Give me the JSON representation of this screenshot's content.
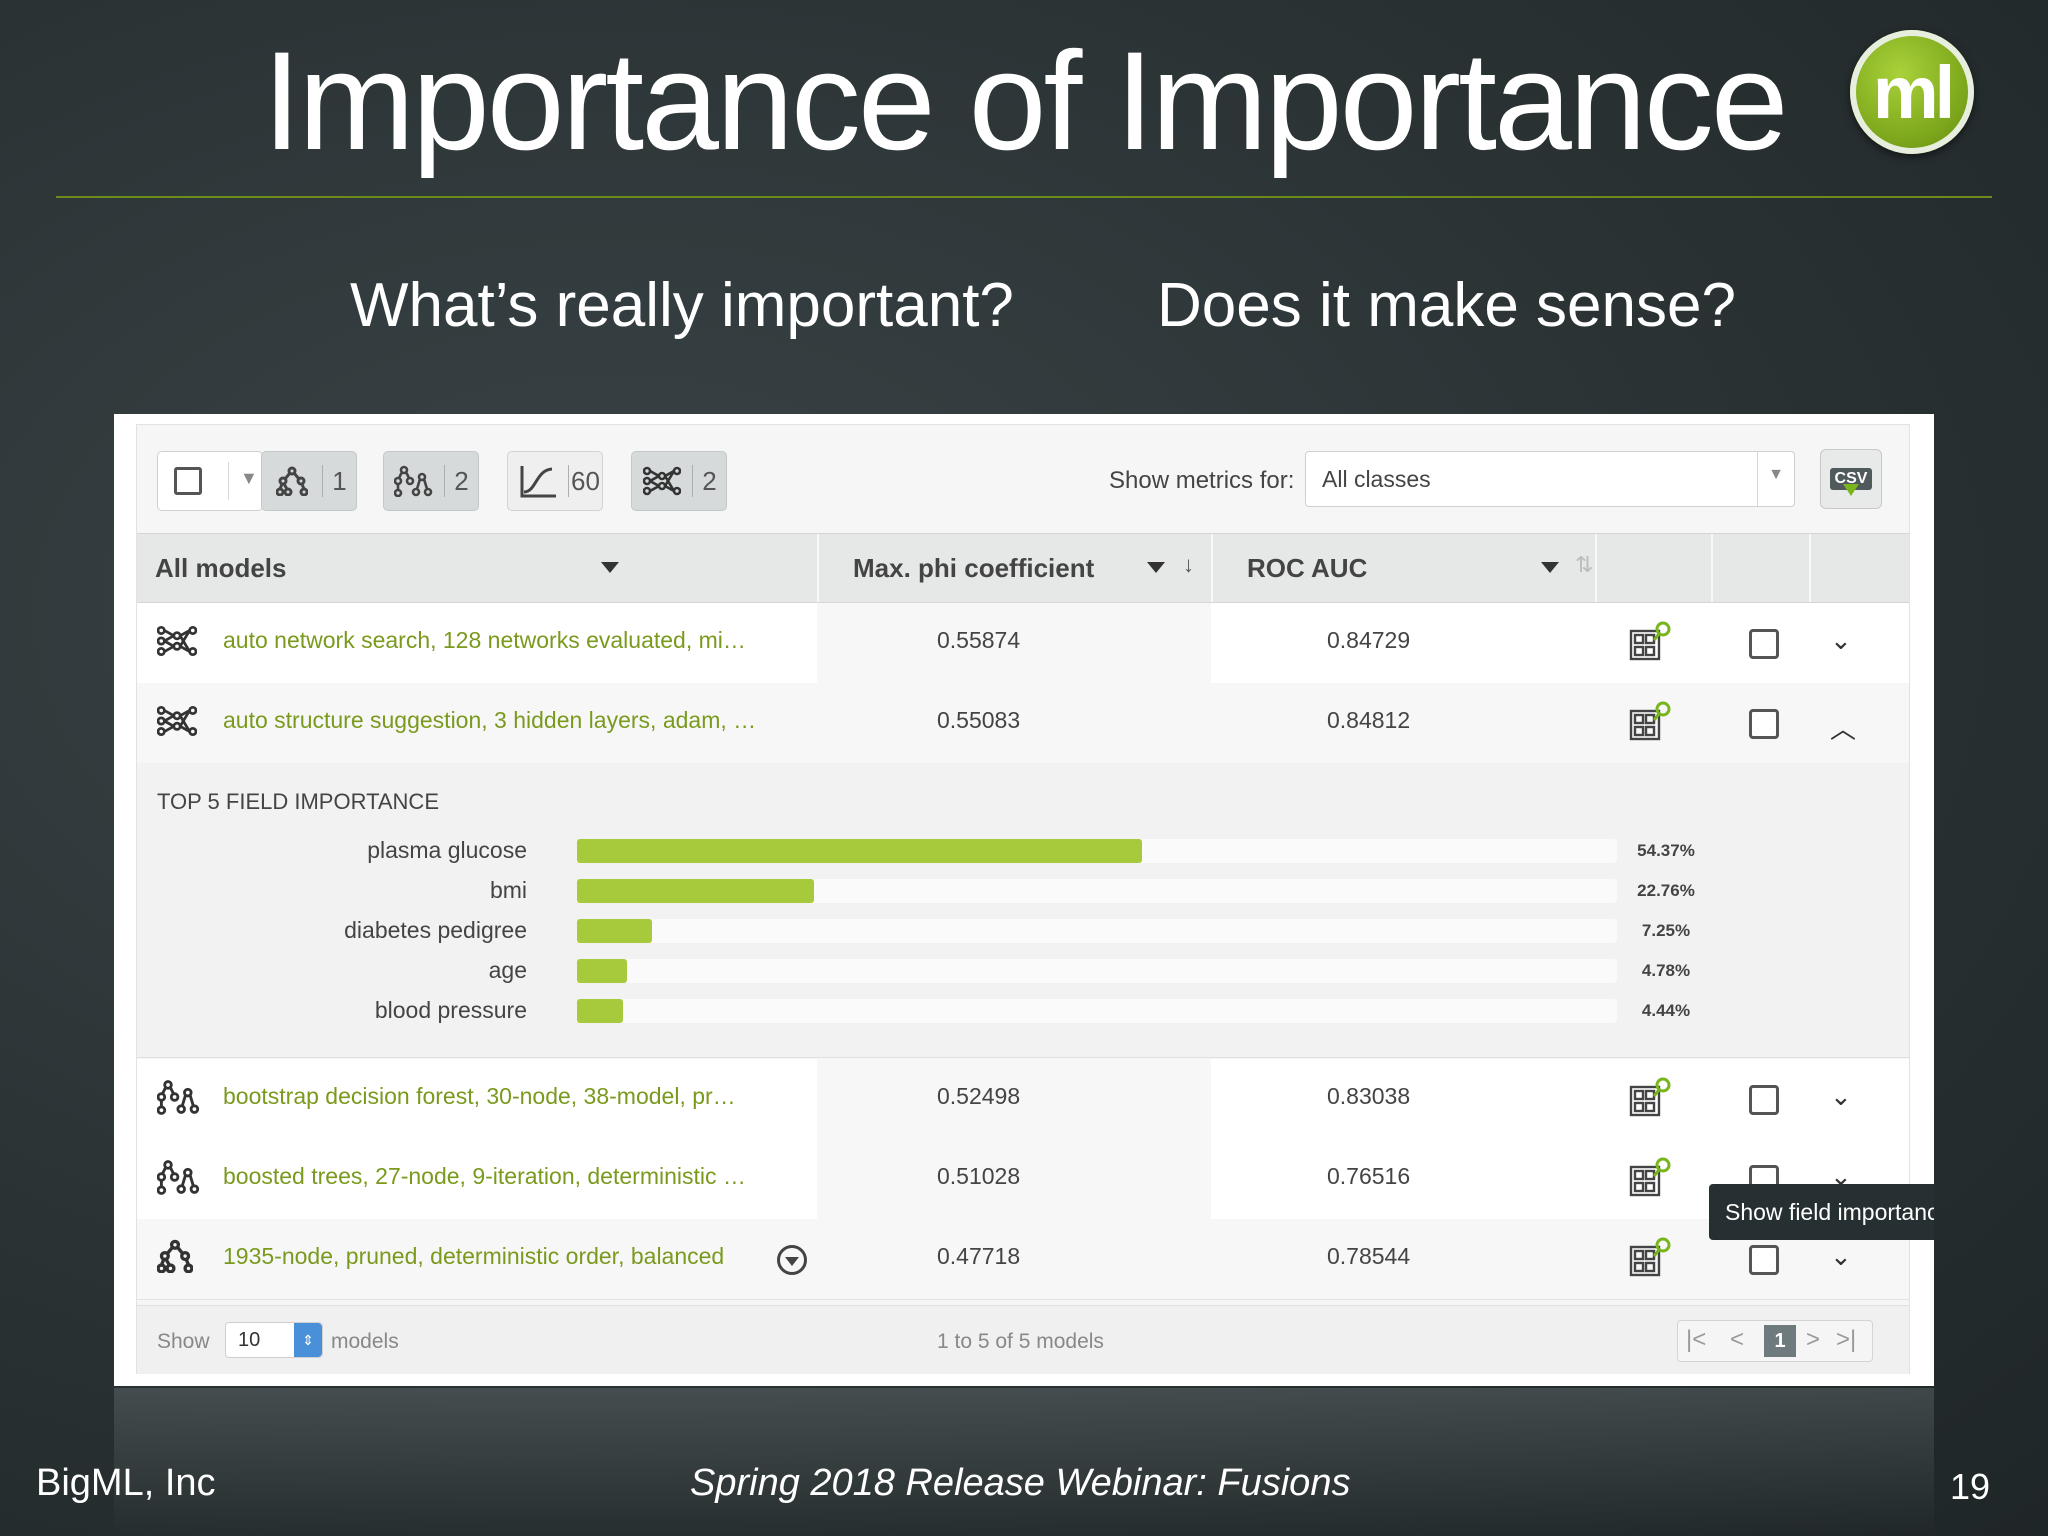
{
  "slide": {
    "title": "Importance of Importance",
    "logo_text": "ml",
    "question_left": "What’s really important?",
    "question_right": "Does it make sense?",
    "footer_left": "BigML, Inc",
    "footer_center": "Spring 2018 Release Webinar: Fusions",
    "page_number": "19"
  },
  "toolbar": {
    "filters": [
      {
        "icon": "tree-model-icon",
        "count": "1"
      },
      {
        "icon": "ensemble-icon",
        "count": "2"
      },
      {
        "icon": "logistic-regression-icon",
        "count": "60"
      },
      {
        "icon": "deepnet-icon",
        "count": "2"
      }
    ],
    "metrics_label": "Show metrics for:",
    "metrics_value": "All classes",
    "csv_label": "CSV"
  },
  "table": {
    "headers": {
      "name": "All models",
      "phi": "Max. phi coefficient",
      "roc": "ROC AUC"
    },
    "rows": [
      {
        "icon": "deepnet-icon",
        "name": "auto network search, 128 networks evaluated, mi…",
        "phi": "0.55874",
        "roc": "0.84729",
        "expanded": false
      },
      {
        "icon": "deepnet-icon",
        "name": "auto structure suggestion, 3 hidden layers, adam, …",
        "phi": "0.55083",
        "roc": "0.84812",
        "expanded": true
      },
      {
        "icon": "ensemble-icon",
        "name": "bootstrap decision forest, 30-node, 38-model, pr…",
        "phi": "0.52498",
        "roc": "0.83038",
        "expanded": false
      },
      {
        "icon": "ensemble-icon",
        "name": "boosted trees, 27-node, 9-iteration, deterministic …",
        "phi": "0.51028",
        "roc": "0.76516",
        "expanded": false
      },
      {
        "icon": "tree-model-icon",
        "name": "1935-node, pruned, deterministic order, balanced",
        "phi": "0.47718",
        "roc": "0.78544",
        "expanded": false
      }
    ]
  },
  "importance": {
    "title": "TOP 5 FIELD IMPORTANCE",
    "fields": [
      {
        "label": "plasma glucose",
        "pct": "54.37%",
        "value": 54.37
      },
      {
        "label": "bmi",
        "pct": "22.76%",
        "value": 22.76
      },
      {
        "label": "diabetes pedigree",
        "pct": "7.25%",
        "value": 7.25
      },
      {
        "label": "age",
        "pct": "4.78%",
        "value": 4.78
      },
      {
        "label": "blood pressure",
        "pct": "4.44%",
        "value": 4.44
      }
    ],
    "bar_color": "#a7c93c"
  },
  "pagination": {
    "show_label": "Show",
    "page_size": "10",
    "models_label": "models",
    "range_text": "1 to 5 of 5 models",
    "current_page": "1"
  },
  "tooltip": {
    "text": "Show field importance"
  },
  "colors": {
    "accent_green": "#7a9a1e",
    "header_bg": "#e6e8e8"
  }
}
